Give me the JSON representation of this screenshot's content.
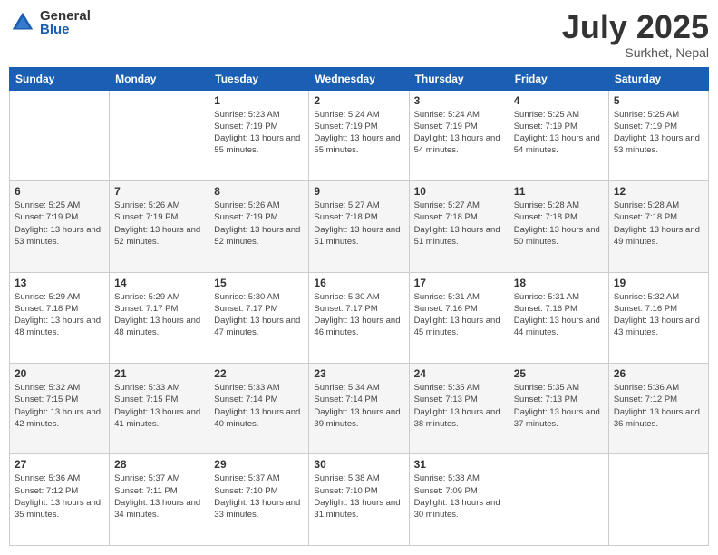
{
  "logo": {
    "general": "General",
    "blue": "Blue"
  },
  "header": {
    "month": "July 2025",
    "location": "Surkhet, Nepal"
  },
  "weekdays": [
    "Sunday",
    "Monday",
    "Tuesday",
    "Wednesday",
    "Thursday",
    "Friday",
    "Saturday"
  ],
  "weeks": [
    [
      {
        "day": "",
        "sunrise": "",
        "sunset": "",
        "daylight": ""
      },
      {
        "day": "",
        "sunrise": "",
        "sunset": "",
        "daylight": ""
      },
      {
        "day": "1",
        "sunrise": "Sunrise: 5:23 AM",
        "sunset": "Sunset: 7:19 PM",
        "daylight": "Daylight: 13 hours and 55 minutes."
      },
      {
        "day": "2",
        "sunrise": "Sunrise: 5:24 AM",
        "sunset": "Sunset: 7:19 PM",
        "daylight": "Daylight: 13 hours and 55 minutes."
      },
      {
        "day": "3",
        "sunrise": "Sunrise: 5:24 AM",
        "sunset": "Sunset: 7:19 PM",
        "daylight": "Daylight: 13 hours and 54 minutes."
      },
      {
        "day": "4",
        "sunrise": "Sunrise: 5:25 AM",
        "sunset": "Sunset: 7:19 PM",
        "daylight": "Daylight: 13 hours and 54 minutes."
      },
      {
        "day": "5",
        "sunrise": "Sunrise: 5:25 AM",
        "sunset": "Sunset: 7:19 PM",
        "daylight": "Daylight: 13 hours and 53 minutes."
      }
    ],
    [
      {
        "day": "6",
        "sunrise": "Sunrise: 5:25 AM",
        "sunset": "Sunset: 7:19 PM",
        "daylight": "Daylight: 13 hours and 53 minutes."
      },
      {
        "day": "7",
        "sunrise": "Sunrise: 5:26 AM",
        "sunset": "Sunset: 7:19 PM",
        "daylight": "Daylight: 13 hours and 52 minutes."
      },
      {
        "day": "8",
        "sunrise": "Sunrise: 5:26 AM",
        "sunset": "Sunset: 7:19 PM",
        "daylight": "Daylight: 13 hours and 52 minutes."
      },
      {
        "day": "9",
        "sunrise": "Sunrise: 5:27 AM",
        "sunset": "Sunset: 7:18 PM",
        "daylight": "Daylight: 13 hours and 51 minutes."
      },
      {
        "day": "10",
        "sunrise": "Sunrise: 5:27 AM",
        "sunset": "Sunset: 7:18 PM",
        "daylight": "Daylight: 13 hours and 51 minutes."
      },
      {
        "day": "11",
        "sunrise": "Sunrise: 5:28 AM",
        "sunset": "Sunset: 7:18 PM",
        "daylight": "Daylight: 13 hours and 50 minutes."
      },
      {
        "day": "12",
        "sunrise": "Sunrise: 5:28 AM",
        "sunset": "Sunset: 7:18 PM",
        "daylight": "Daylight: 13 hours and 49 minutes."
      }
    ],
    [
      {
        "day": "13",
        "sunrise": "Sunrise: 5:29 AM",
        "sunset": "Sunset: 7:18 PM",
        "daylight": "Daylight: 13 hours and 48 minutes."
      },
      {
        "day": "14",
        "sunrise": "Sunrise: 5:29 AM",
        "sunset": "Sunset: 7:17 PM",
        "daylight": "Daylight: 13 hours and 48 minutes."
      },
      {
        "day": "15",
        "sunrise": "Sunrise: 5:30 AM",
        "sunset": "Sunset: 7:17 PM",
        "daylight": "Daylight: 13 hours and 47 minutes."
      },
      {
        "day": "16",
        "sunrise": "Sunrise: 5:30 AM",
        "sunset": "Sunset: 7:17 PM",
        "daylight": "Daylight: 13 hours and 46 minutes."
      },
      {
        "day": "17",
        "sunrise": "Sunrise: 5:31 AM",
        "sunset": "Sunset: 7:16 PM",
        "daylight": "Daylight: 13 hours and 45 minutes."
      },
      {
        "day": "18",
        "sunrise": "Sunrise: 5:31 AM",
        "sunset": "Sunset: 7:16 PM",
        "daylight": "Daylight: 13 hours and 44 minutes."
      },
      {
        "day": "19",
        "sunrise": "Sunrise: 5:32 AM",
        "sunset": "Sunset: 7:16 PM",
        "daylight": "Daylight: 13 hours and 43 minutes."
      }
    ],
    [
      {
        "day": "20",
        "sunrise": "Sunrise: 5:32 AM",
        "sunset": "Sunset: 7:15 PM",
        "daylight": "Daylight: 13 hours and 42 minutes."
      },
      {
        "day": "21",
        "sunrise": "Sunrise: 5:33 AM",
        "sunset": "Sunset: 7:15 PM",
        "daylight": "Daylight: 13 hours and 41 minutes."
      },
      {
        "day": "22",
        "sunrise": "Sunrise: 5:33 AM",
        "sunset": "Sunset: 7:14 PM",
        "daylight": "Daylight: 13 hours and 40 minutes."
      },
      {
        "day": "23",
        "sunrise": "Sunrise: 5:34 AM",
        "sunset": "Sunset: 7:14 PM",
        "daylight": "Daylight: 13 hours and 39 minutes."
      },
      {
        "day": "24",
        "sunrise": "Sunrise: 5:35 AM",
        "sunset": "Sunset: 7:13 PM",
        "daylight": "Daylight: 13 hours and 38 minutes."
      },
      {
        "day": "25",
        "sunrise": "Sunrise: 5:35 AM",
        "sunset": "Sunset: 7:13 PM",
        "daylight": "Daylight: 13 hours and 37 minutes."
      },
      {
        "day": "26",
        "sunrise": "Sunrise: 5:36 AM",
        "sunset": "Sunset: 7:12 PM",
        "daylight": "Daylight: 13 hours and 36 minutes."
      }
    ],
    [
      {
        "day": "27",
        "sunrise": "Sunrise: 5:36 AM",
        "sunset": "Sunset: 7:12 PM",
        "daylight": "Daylight: 13 hours and 35 minutes."
      },
      {
        "day": "28",
        "sunrise": "Sunrise: 5:37 AM",
        "sunset": "Sunset: 7:11 PM",
        "daylight": "Daylight: 13 hours and 34 minutes."
      },
      {
        "day": "29",
        "sunrise": "Sunrise: 5:37 AM",
        "sunset": "Sunset: 7:10 PM",
        "daylight": "Daylight: 13 hours and 33 minutes."
      },
      {
        "day": "30",
        "sunrise": "Sunrise: 5:38 AM",
        "sunset": "Sunset: 7:10 PM",
        "daylight": "Daylight: 13 hours and 31 minutes."
      },
      {
        "day": "31",
        "sunrise": "Sunrise: 5:38 AM",
        "sunset": "Sunset: 7:09 PM",
        "daylight": "Daylight: 13 hours and 30 minutes."
      },
      {
        "day": "",
        "sunrise": "",
        "sunset": "",
        "daylight": ""
      },
      {
        "day": "",
        "sunrise": "",
        "sunset": "",
        "daylight": ""
      }
    ]
  ]
}
